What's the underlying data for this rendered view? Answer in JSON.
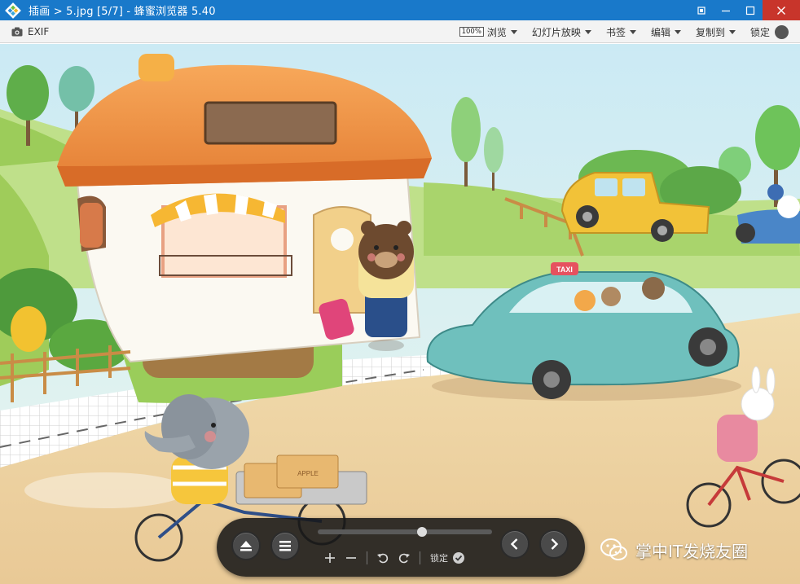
{
  "window": {
    "title": "插画 > 5.jpg [5/7] - 蜂蜜浏览器 5.40"
  },
  "toolbar": {
    "exif_label": "EXIF",
    "zoom_badge": "100%",
    "menus": [
      {
        "label": "浏览"
      },
      {
        "label": "幻灯片放映"
      },
      {
        "label": "书签"
      },
      {
        "label": "编辑"
      },
      {
        "label": "复制到"
      }
    ],
    "lock_label": "锁定"
  },
  "image": {
    "taxi_sign": "TAXI",
    "crate_label": "APPLE"
  },
  "control_panel": {
    "lock_label": "锁定",
    "slider_value": 0.6
  },
  "watermark": {
    "text": "掌中IT发烧友圈"
  },
  "colors": {
    "titlebar": "#1979ca",
    "close_button": "#c8352b",
    "panel": "#181818"
  }
}
